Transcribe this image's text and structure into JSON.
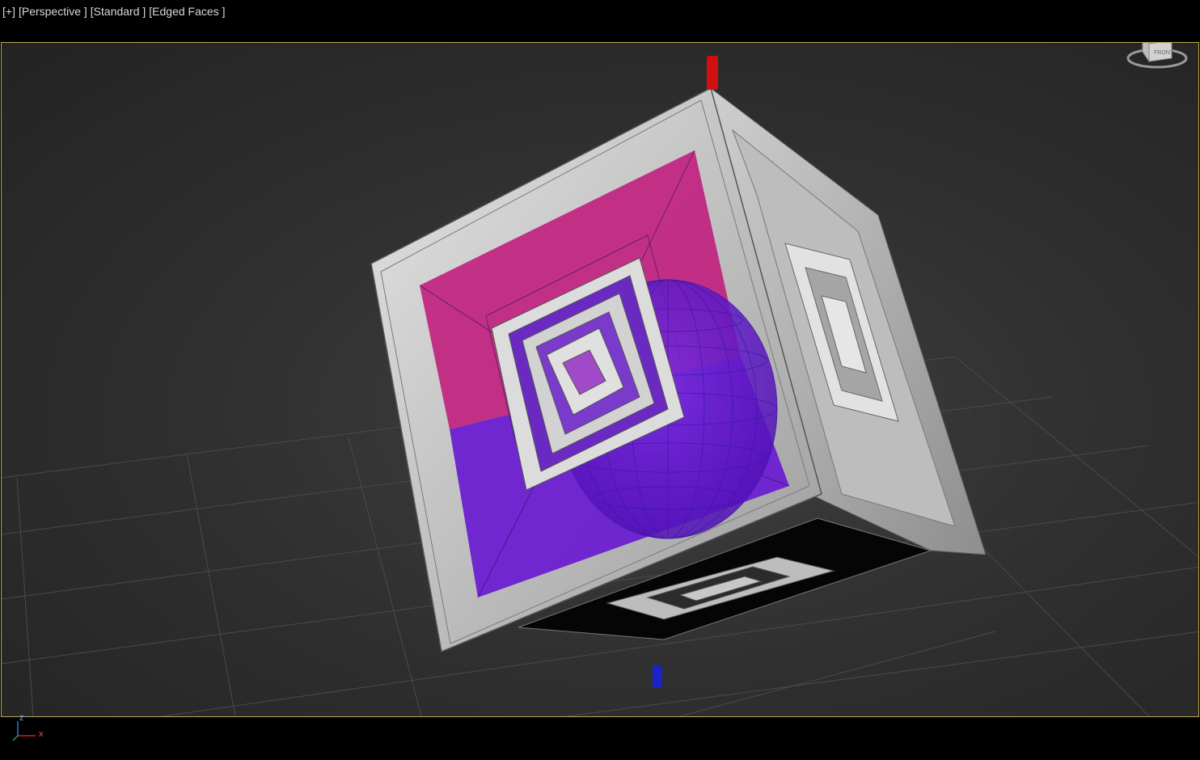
{
  "viewport_labels": {
    "menu": "[+]",
    "view": "[Perspective ]",
    "shading": "[Standard ]",
    "display": "[Edged Faces ]"
  },
  "viewcube": {
    "face_label": "FRONT"
  },
  "axis_tripod": {
    "x": "x",
    "z": "z"
  },
  "colors": {
    "viewport_border": "#b9a84a",
    "magenta_panel": "#c0237f",
    "purple_panel": "#6b1fd0",
    "sphere_wire": "#3a1aa8",
    "gizmo_top": "#d01010",
    "gizmo_bottom": "#1a23c8"
  }
}
